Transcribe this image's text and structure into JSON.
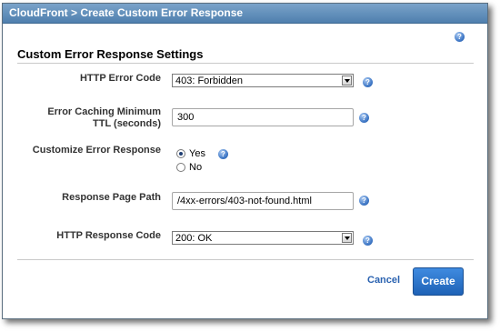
{
  "dialog": {
    "breadcrumb": "CloudFront > Create Custom Error Response"
  },
  "section": {
    "title": "Custom Error Response Settings"
  },
  "fields": {
    "http_error_code": {
      "label": "HTTP Error Code",
      "value": "403: Forbidden"
    },
    "error_caching_ttl": {
      "label_line1": "Error Caching Minimum",
      "label_line2": "TTL (seconds)",
      "value": "300"
    },
    "customize_error_response": {
      "label": "Customize Error Response",
      "options": [
        "Yes",
        "No"
      ],
      "selected": "Yes"
    },
    "response_page_path": {
      "label": "Response Page Path",
      "value": "/4xx-errors/403-not-found.html"
    },
    "http_response_code": {
      "label": "HTTP Response Code",
      "value": "200: OK"
    }
  },
  "actions": {
    "cancel_label": "Cancel",
    "create_label": "Create"
  },
  "icons": {
    "help": "help-icon",
    "help_glyph": "?"
  },
  "colors": {
    "titlebar": "#5b88b6",
    "primary_button": "#2a74cc",
    "link": "#2a62b0",
    "help_icon": "#3d76c5"
  }
}
